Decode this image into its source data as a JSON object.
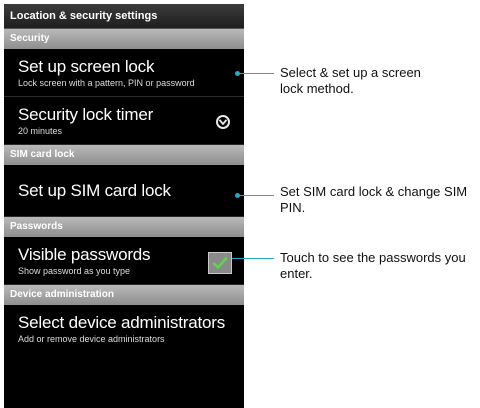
{
  "window": {
    "title": "Location & security settings"
  },
  "sections": [
    {
      "header": "Security",
      "items": [
        {
          "title": "Set up screen lock",
          "summary": "Lock screen with a pattern, PIN or password"
        },
        {
          "title": "Security lock timer",
          "summary": "20 minutes",
          "icon": "clock-dropdown-icon"
        }
      ]
    },
    {
      "header": "SIM card lock",
      "items": [
        {
          "title": "Set up SIM card lock"
        }
      ]
    },
    {
      "header": "Passwords",
      "items": [
        {
          "title": "Visible passwords",
          "summary": "Show password as you type",
          "checked": true
        }
      ]
    },
    {
      "header": "Device administration",
      "items": [
        {
          "title": "Select device administrators",
          "summary": "Add or remove device administrators"
        }
      ]
    }
  ],
  "callouts": [
    "Select & set up a screen lock method.",
    "Set SIM card lock & change SIM PIN.",
    "Touch to see the passwords you enter."
  ],
  "colors": {
    "accent_line": "#21a9c9",
    "checkmark": "#5fd54a",
    "section_header": "#9e9e9e"
  }
}
